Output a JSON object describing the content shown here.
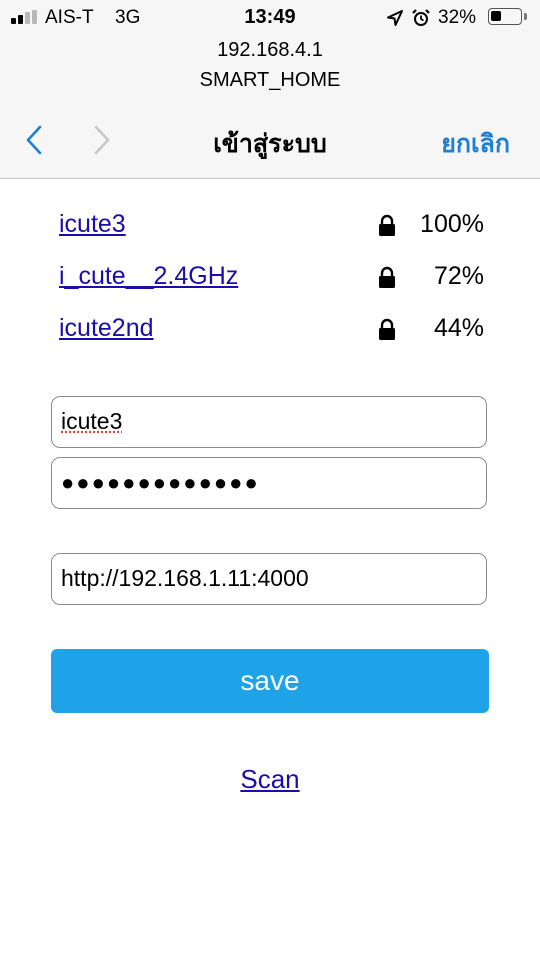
{
  "status_bar": {
    "carrier": "AIS-T",
    "network": "3G",
    "time": "13:49",
    "battery_percent": "32%",
    "battery_level": 0.32
  },
  "browser": {
    "host": "192.168.4.1",
    "page_title": "SMART_HOME",
    "nav_title": "เข้าสู่ระบบ",
    "cancel_label": "ยกเลิก"
  },
  "networks": [
    {
      "ssid": "icute3",
      "signal": "100%"
    },
    {
      "ssid": "i_cute__2.4GHz",
      "signal": "72%"
    },
    {
      "ssid": "icute2nd",
      "signal": "44%"
    }
  ],
  "form": {
    "ssid_value": "icute3",
    "password_value": "●●●●●●●●●●●●●",
    "server_value": "http://192.168.1.11:4000",
    "save_label": "save",
    "scan_label": "Scan"
  },
  "icons": {
    "signal": "cellular-signal-icon",
    "location": "location-arrow-icon",
    "alarm": "alarm-clock-icon",
    "battery": "battery-icon",
    "back": "chevron-left-icon",
    "forward": "chevron-right-icon",
    "lock": "lock-icon"
  },
  "colors": {
    "accent": "#1e7fd6",
    "link": "#1a0dab",
    "save_button": "#1fa3e8"
  }
}
